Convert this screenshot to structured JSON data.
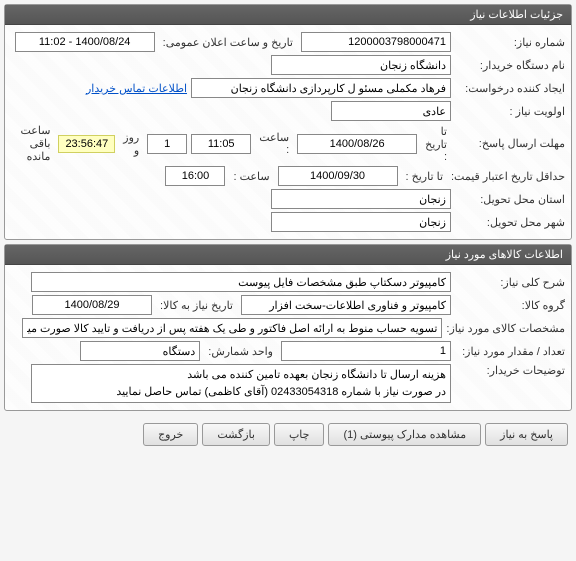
{
  "panel1": {
    "title": "جزئیات اطلاعات نیاز",
    "need_no_label": "شماره نیاز:",
    "need_no": "1200003798000471",
    "announce_label": "تاریخ و ساعت اعلان عمومی:",
    "announce_val": "1400/08/24 - 11:02",
    "buyer_label": "نام دستگاه خریدار:",
    "buyer_val": "دانشگاه زنجان",
    "creator_label": "ایجاد کننده درخواست:",
    "creator_val": "فرهاد مکملی مسئو ل کارپردازی دانشگاه زنجان",
    "contact_link": "اطلاعات تماس خریدار",
    "priority_label": "اولویت نیاز :",
    "priority_val": "عادی",
    "reply_deadline_label": "مهلت ارسال پاسخ:",
    "to_date_label": "تا تاریخ :",
    "reply_date": "1400/08/26",
    "time_label": "ساعت :",
    "reply_time": "11:05",
    "days_val": "1",
    "days_label": "روز و",
    "countdown": "23:56:47",
    "remain_label": "ساعت باقی مانده",
    "price_valid_label": "حداقل تاریخ اعتبار قیمت:",
    "price_date": "1400/09/30",
    "price_time": "16:00",
    "province_label": "استان محل تحویل:",
    "province_val": "زنجان",
    "city_label": "شهر محل تحویل:",
    "city_val": "زنجان"
  },
  "panel2": {
    "title": "اطلاعات کالاهای مورد نیاز",
    "desc_label": "شرح کلی نیاز:",
    "desc_val": "کامپیوتر دسکتاپ طبق مشخصات فایل پیوست",
    "group_label": "گروه کالا:",
    "group_val": "کامپیوتر و فناوری اطلاعات-سخت افزار",
    "need_date_label": "تاریخ نیاز به کالا:",
    "need_date_val": "1400/08/29",
    "spec_label": "مشخصات کالای مورد نیاز:",
    "spec_val": "تسویه حساب منوط به ارائه اصل فاکتور و طی یک هفته پس از دریافت و تایید کالا صورت میگیرد",
    "qty_label": "تعداد / مقدار مورد نیاز:",
    "qty_val": "1",
    "unit_label": "واحد شمارش:",
    "unit_val": "دستگاه",
    "notes_label": "توضیحات خریدار:",
    "notes_val": "هزینه ارسال تا دانشگاه زنجان بعهده تامین کننده می باشد\nدر صورت نیاز با شماره 02433054318 (آقای کاظمی) تماس حاصل نمایید"
  },
  "footer": {
    "reply": "پاسخ به نیاز",
    "attach": "مشاهده مدارک پیوستی (1)",
    "print": "چاپ",
    "back": "بازگشت",
    "exit": "خروج"
  }
}
